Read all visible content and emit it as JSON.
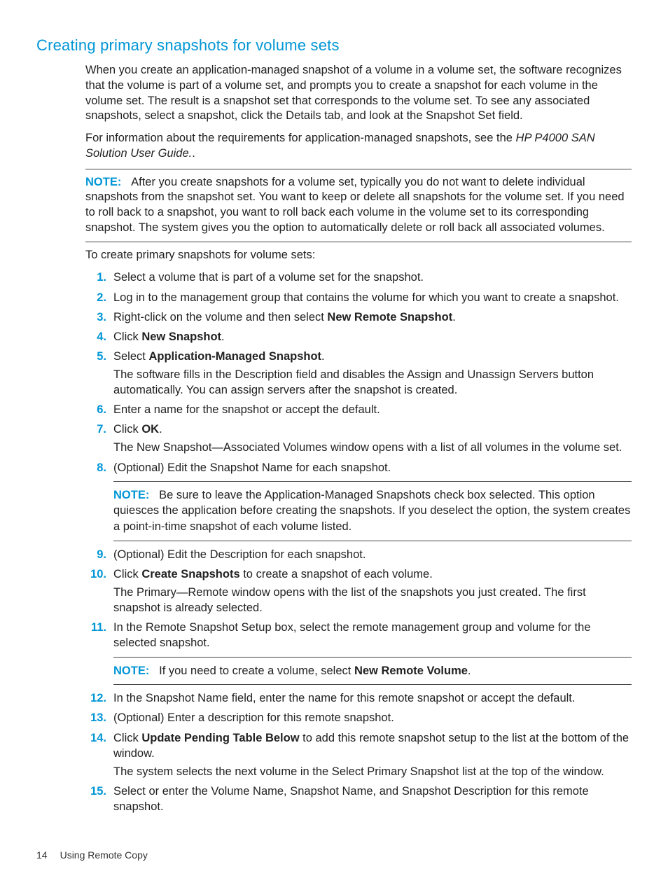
{
  "title": "Creating primary snapshots for volume sets",
  "para1": "When you create an application-managed snapshot of a volume in a volume set, the software recognizes that the volume is part of a volume set, and prompts you to create a snapshot for each volume in the volume set. The result is a snapshot set that corresponds to the volume set. To see any associated snapshots, select a snapshot, click the Details tab, and look at the Snapshot Set field.",
  "para2a": "For information about the requirements for application-managed snapshots, see the ",
  "para2b": "HP P4000 SAN Solution User Guide.",
  "para2c": ".",
  "topNote": {
    "label": "NOTE:",
    "text": "After you create snapshots for a volume set, typically you do not want to delete individual snapshots from the snapshot set. You want to keep or delete all snapshots for the volume set. If you need to roll back to a snapshot, you want to roll back each volume in the volume set to its corresponding snapshot. The system gives you the option to automatically delete or roll back all associated volumes."
  },
  "intro": "To create primary snapshots for volume sets:",
  "steps": {
    "s1": "Select a volume that is part of a volume set for the snapshot.",
    "s2": "Log in to the management group that contains the volume for which you want to create a snapshot.",
    "s3a": "Right-click on the volume and then select ",
    "s3b": "New Remote Snapshot",
    "s3c": ".",
    "s4a": "Click ",
    "s4b": "New Snapshot",
    "s4c": ".",
    "s5a": "Select ",
    "s5b": "Application-Managed Snapshot",
    "s5c": ".",
    "s5p": "The software fills in the Description field and disables the Assign and Unassign Servers button automatically. You can assign servers after the snapshot is created.",
    "s6": "Enter a name for the snapshot or accept the default.",
    "s7a": "Click ",
    "s7b": "OK",
    "s7c": ".",
    "s7p": "The New Snapshot—Associated Volumes window opens with a list of all volumes in the volume set.",
    "s8": "(Optional) Edit the Snapshot Name for each snapshot.",
    "s8note": {
      "label": "NOTE:",
      "text": "Be sure to leave the Application-Managed Snapshots check box selected. This option quiesces the application before creating the snapshots. If you deselect the option, the system creates a point-in-time snapshot of each volume listed."
    },
    "s9": "(Optional) Edit the Description for each snapshot.",
    "s10a": "Click ",
    "s10b": "Create Snapshots",
    "s10c": " to create a snapshot of each volume.",
    "s10p": "The Primary—Remote window opens with the list of the snapshots you just created. The first snapshot is already selected.",
    "s11": "In the Remote Snapshot Setup box, select the remote management group and volume for the selected snapshot.",
    "s11note": {
      "label": "NOTE:",
      "textA": "If you need to create a volume, select ",
      "textB": "New Remote Volume",
      "textC": "."
    },
    "s12": "In the Snapshot Name field, enter the name for this remote snapshot or accept the default.",
    "s13": "(Optional) Enter a description for this remote snapshot.",
    "s14a": "Click ",
    "s14b": "Update Pending Table Below",
    "s14c": " to add this remote snapshot setup to the list at the bottom of the window.",
    "s14p": "The system selects the next volume in the Select Primary Snapshot list at the top of the window.",
    "s15": "Select or enter the Volume Name, Snapshot Name, and Snapshot Description for this remote snapshot."
  },
  "nums": {
    "n1": "1.",
    "n2": "2.",
    "n3": "3.",
    "n4": "4.",
    "n5": "5.",
    "n6": "6.",
    "n7": "7.",
    "n8": "8.",
    "n9": "9.",
    "n10": "10.",
    "n11": "11.",
    "n12": "12.",
    "n13": "13.",
    "n14": "14.",
    "n15": "15."
  },
  "footer": {
    "page": "14",
    "section": "Using Remote Copy"
  }
}
